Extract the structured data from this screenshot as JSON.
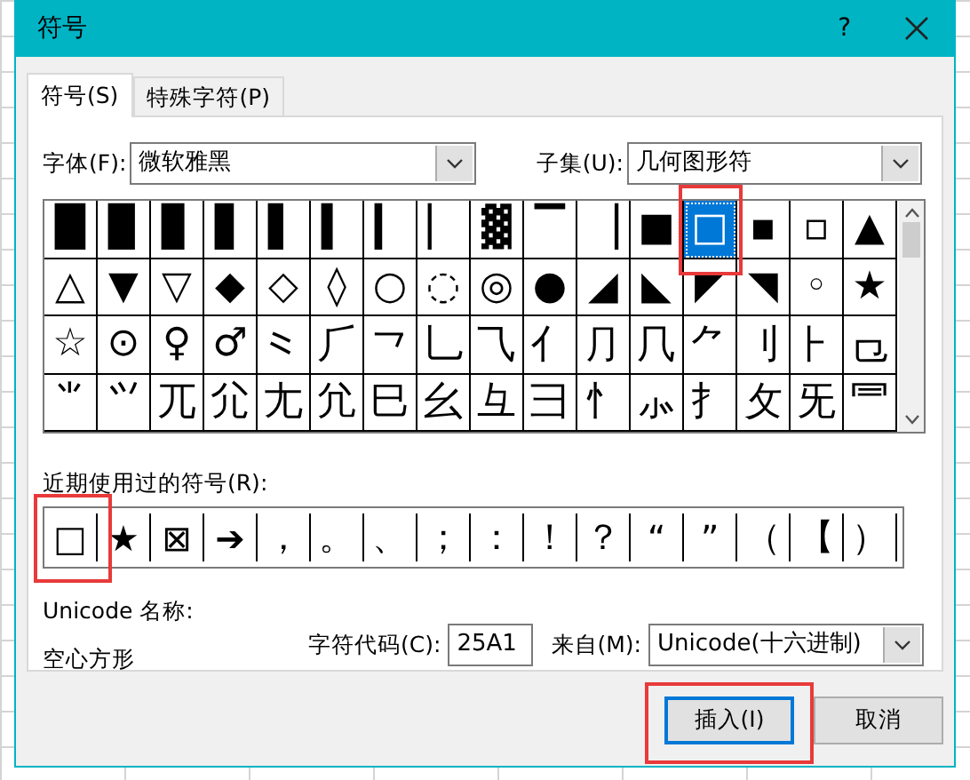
{
  "window": {
    "title": "符号",
    "help": "?"
  },
  "tabs": [
    {
      "label": "符号(S)",
      "selected": true
    },
    {
      "label": "特殊字符(P)",
      "selected": false
    }
  ],
  "font": {
    "label": "字体(F):",
    "value": "微软雅黑"
  },
  "subset": {
    "label": "子集(U):",
    "value": "几何图形符"
  },
  "symbols": [
    {
      "char": "█",
      "selected": false,
      "marked": false
    },
    {
      "char": "▉",
      "selected": false,
      "marked": false
    },
    {
      "char": "▊",
      "selected": false,
      "marked": false
    },
    {
      "char": "▋",
      "selected": false,
      "marked": false
    },
    {
      "char": "▌",
      "selected": false,
      "marked": false
    },
    {
      "char": "▍",
      "selected": false,
      "marked": false
    },
    {
      "char": "▎",
      "selected": false,
      "marked": false
    },
    {
      "char": "▏",
      "selected": false,
      "marked": false
    },
    {
      "char": "▓",
      "selected": false,
      "marked": false
    },
    {
      "char": "▔",
      "selected": false,
      "marked": false
    },
    {
      "char": "▕",
      "selected": false,
      "marked": false
    },
    {
      "char": "■",
      "selected": false,
      "marked": false
    },
    {
      "char": "□",
      "selected": true,
      "marked": true
    },
    {
      "char": "▪",
      "selected": false,
      "marked": false
    },
    {
      "char": "▫",
      "selected": false,
      "marked": false
    },
    {
      "char": "▲",
      "selected": false,
      "marked": false
    },
    {
      "char": "△",
      "selected": false,
      "marked": false
    },
    {
      "char": "▼",
      "selected": false,
      "marked": false
    },
    {
      "char": "▽",
      "selected": false,
      "marked": false
    },
    {
      "char": "◆",
      "selected": false,
      "marked": false
    },
    {
      "char": "◇",
      "selected": false,
      "marked": false
    },
    {
      "char": "◊",
      "selected": false,
      "marked": false
    },
    {
      "char": "○",
      "selected": false,
      "marked": false
    },
    {
      "char": "◌",
      "selected": false,
      "marked": false
    },
    {
      "char": "◎",
      "selected": false,
      "marked": false
    },
    {
      "char": "●",
      "selected": false,
      "marked": false
    },
    {
      "char": "◢",
      "selected": false,
      "marked": false
    },
    {
      "char": "◣",
      "selected": false,
      "marked": false
    },
    {
      "char": "◤",
      "selected": false,
      "marked": false
    },
    {
      "char": "◥",
      "selected": false,
      "marked": false
    },
    {
      "char": "◦",
      "selected": false,
      "marked": false
    },
    {
      "char": "★",
      "selected": false,
      "marked": false
    },
    {
      "char": "☆",
      "selected": false,
      "marked": false
    },
    {
      "char": "⊙",
      "selected": false,
      "marked": false
    },
    {
      "char": "♀",
      "selected": false,
      "marked": false
    },
    {
      "char": "♂",
      "selected": false,
      "marked": false
    },
    {
      "char": "⺀",
      "selected": false,
      "marked": false
    },
    {
      "char": "⺁",
      "selected": false,
      "marked": false
    },
    {
      "char": "⺂",
      "selected": false,
      "marked": false
    },
    {
      "char": "⺃",
      "selected": false,
      "marked": false
    },
    {
      "char": "⺄",
      "selected": false,
      "marked": false
    },
    {
      "char": "⺅",
      "selected": false,
      "marked": false
    },
    {
      "char": "⺆",
      "selected": false,
      "marked": false
    },
    {
      "char": "⺇",
      "selected": false,
      "marked": false
    },
    {
      "char": "⺈",
      "selected": false,
      "marked": false
    },
    {
      "char": "⺉",
      "selected": false,
      "marked": false
    },
    {
      "char": "⺊",
      "selected": false,
      "marked": false
    },
    {
      "char": "⺋",
      "selected": false,
      "marked": false
    },
    {
      "char": "⺌",
      "selected": false,
      "marked": false
    },
    {
      "char": "⺍",
      "selected": false,
      "marked": false
    },
    {
      "char": "⺎",
      "selected": false,
      "marked": false
    },
    {
      "char": "⺏",
      "selected": false,
      "marked": false
    },
    {
      "char": "⺐",
      "selected": false,
      "marked": false
    },
    {
      "char": "⺑",
      "selected": false,
      "marked": false
    },
    {
      "char": "⺒",
      "selected": false,
      "marked": false
    },
    {
      "char": "⺓",
      "selected": false,
      "marked": false
    },
    {
      "char": "⺔",
      "selected": false,
      "marked": false
    },
    {
      "char": "⺕",
      "selected": false,
      "marked": false
    },
    {
      "char": "⺖",
      "selected": false,
      "marked": false
    },
    {
      "char": "⺗",
      "selected": false,
      "marked": false
    },
    {
      "char": "⺘",
      "selected": false,
      "marked": false
    },
    {
      "char": "⺙",
      "selected": false,
      "marked": false
    },
    {
      "char": "⺛",
      "selected": false,
      "marked": false
    },
    {
      "char": "⺜",
      "selected": false,
      "marked": false
    }
  ],
  "recent": {
    "label": "近期使用过的符号(R):",
    "symbols": [
      {
        "char": "□",
        "marked": true
      },
      {
        "char": "★",
        "marked": false
      },
      {
        "char": "⊠",
        "marked": false
      },
      {
        "char": "➔",
        "marked": false
      },
      {
        "char": "，",
        "marked": false
      },
      {
        "char": "。",
        "marked": false
      },
      {
        "char": "、",
        "marked": false
      },
      {
        "char": "；",
        "marked": false
      },
      {
        "char": "：",
        "marked": false
      },
      {
        "char": "！",
        "marked": false
      },
      {
        "char": "？",
        "marked": false
      },
      {
        "char": "“",
        "marked": false
      },
      {
        "char": "”",
        "marked": false
      },
      {
        "char": "（",
        "marked": false
      },
      {
        "char": "【",
        "marked": false
      },
      {
        "char": "）",
        "marked": false
      }
    ]
  },
  "unicode_name": {
    "label": "Unicode 名称:",
    "value": "空心方形"
  },
  "char_code": {
    "label": "字符代码(C):",
    "value": "25A1"
  },
  "from": {
    "label": "来自(M):",
    "value": "Unicode(十六进制)"
  },
  "buttons": [
    {
      "label": "插入(I)",
      "default": true,
      "marked": true
    },
    {
      "label": "取消",
      "default": false,
      "marked": false
    }
  ]
}
